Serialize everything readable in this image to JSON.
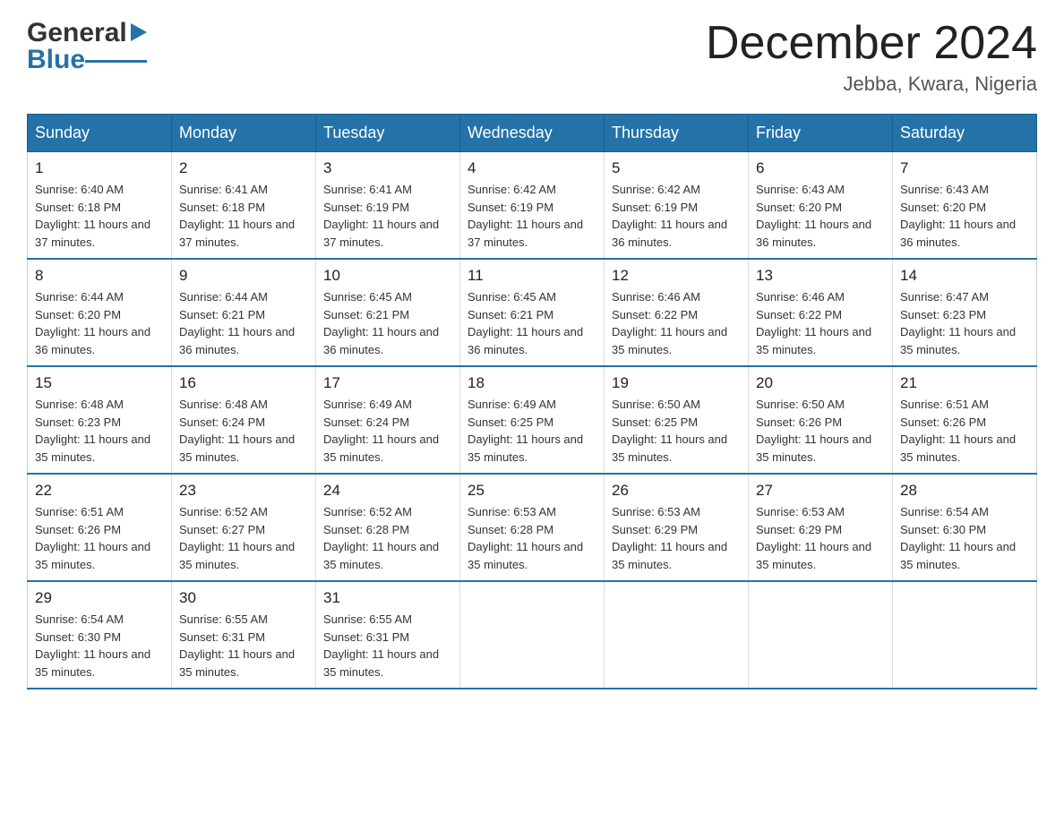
{
  "header": {
    "logo_general": "General",
    "logo_blue": "Blue",
    "month_title": "December 2024",
    "location": "Jebba, Kwara, Nigeria"
  },
  "weekdays": [
    "Sunday",
    "Monday",
    "Tuesday",
    "Wednesday",
    "Thursday",
    "Friday",
    "Saturday"
  ],
  "weeks": [
    [
      {
        "day": "1",
        "sunrise": "6:40 AM",
        "sunset": "6:18 PM",
        "daylight": "11 hours and 37 minutes."
      },
      {
        "day": "2",
        "sunrise": "6:41 AM",
        "sunset": "6:18 PM",
        "daylight": "11 hours and 37 minutes."
      },
      {
        "day": "3",
        "sunrise": "6:41 AM",
        "sunset": "6:19 PM",
        "daylight": "11 hours and 37 minutes."
      },
      {
        "day": "4",
        "sunrise": "6:42 AM",
        "sunset": "6:19 PM",
        "daylight": "11 hours and 37 minutes."
      },
      {
        "day": "5",
        "sunrise": "6:42 AM",
        "sunset": "6:19 PM",
        "daylight": "11 hours and 36 minutes."
      },
      {
        "day": "6",
        "sunrise": "6:43 AM",
        "sunset": "6:20 PM",
        "daylight": "11 hours and 36 minutes."
      },
      {
        "day": "7",
        "sunrise": "6:43 AM",
        "sunset": "6:20 PM",
        "daylight": "11 hours and 36 minutes."
      }
    ],
    [
      {
        "day": "8",
        "sunrise": "6:44 AM",
        "sunset": "6:20 PM",
        "daylight": "11 hours and 36 minutes."
      },
      {
        "day": "9",
        "sunrise": "6:44 AM",
        "sunset": "6:21 PM",
        "daylight": "11 hours and 36 minutes."
      },
      {
        "day": "10",
        "sunrise": "6:45 AM",
        "sunset": "6:21 PM",
        "daylight": "11 hours and 36 minutes."
      },
      {
        "day": "11",
        "sunrise": "6:45 AM",
        "sunset": "6:21 PM",
        "daylight": "11 hours and 36 minutes."
      },
      {
        "day": "12",
        "sunrise": "6:46 AM",
        "sunset": "6:22 PM",
        "daylight": "11 hours and 35 minutes."
      },
      {
        "day": "13",
        "sunrise": "6:46 AM",
        "sunset": "6:22 PM",
        "daylight": "11 hours and 35 minutes."
      },
      {
        "day": "14",
        "sunrise": "6:47 AM",
        "sunset": "6:23 PM",
        "daylight": "11 hours and 35 minutes."
      }
    ],
    [
      {
        "day": "15",
        "sunrise": "6:48 AM",
        "sunset": "6:23 PM",
        "daylight": "11 hours and 35 minutes."
      },
      {
        "day": "16",
        "sunrise": "6:48 AM",
        "sunset": "6:24 PM",
        "daylight": "11 hours and 35 minutes."
      },
      {
        "day": "17",
        "sunrise": "6:49 AM",
        "sunset": "6:24 PM",
        "daylight": "11 hours and 35 minutes."
      },
      {
        "day": "18",
        "sunrise": "6:49 AM",
        "sunset": "6:25 PM",
        "daylight": "11 hours and 35 minutes."
      },
      {
        "day": "19",
        "sunrise": "6:50 AM",
        "sunset": "6:25 PM",
        "daylight": "11 hours and 35 minutes."
      },
      {
        "day": "20",
        "sunrise": "6:50 AM",
        "sunset": "6:26 PM",
        "daylight": "11 hours and 35 minutes."
      },
      {
        "day": "21",
        "sunrise": "6:51 AM",
        "sunset": "6:26 PM",
        "daylight": "11 hours and 35 minutes."
      }
    ],
    [
      {
        "day": "22",
        "sunrise": "6:51 AM",
        "sunset": "6:26 PM",
        "daylight": "11 hours and 35 minutes."
      },
      {
        "day": "23",
        "sunrise": "6:52 AM",
        "sunset": "6:27 PM",
        "daylight": "11 hours and 35 minutes."
      },
      {
        "day": "24",
        "sunrise": "6:52 AM",
        "sunset": "6:28 PM",
        "daylight": "11 hours and 35 minutes."
      },
      {
        "day": "25",
        "sunrise": "6:53 AM",
        "sunset": "6:28 PM",
        "daylight": "11 hours and 35 minutes."
      },
      {
        "day": "26",
        "sunrise": "6:53 AM",
        "sunset": "6:29 PM",
        "daylight": "11 hours and 35 minutes."
      },
      {
        "day": "27",
        "sunrise": "6:53 AM",
        "sunset": "6:29 PM",
        "daylight": "11 hours and 35 minutes."
      },
      {
        "day": "28",
        "sunrise": "6:54 AM",
        "sunset": "6:30 PM",
        "daylight": "11 hours and 35 minutes."
      }
    ],
    [
      {
        "day": "29",
        "sunrise": "6:54 AM",
        "sunset": "6:30 PM",
        "daylight": "11 hours and 35 minutes."
      },
      {
        "day": "30",
        "sunrise": "6:55 AM",
        "sunset": "6:31 PM",
        "daylight": "11 hours and 35 minutes."
      },
      {
        "day": "31",
        "sunrise": "6:55 AM",
        "sunset": "6:31 PM",
        "daylight": "11 hours and 35 minutes."
      },
      null,
      null,
      null,
      null
    ]
  ],
  "labels": {
    "sunrise": "Sunrise:",
    "sunset": "Sunset:",
    "daylight": "Daylight:"
  }
}
